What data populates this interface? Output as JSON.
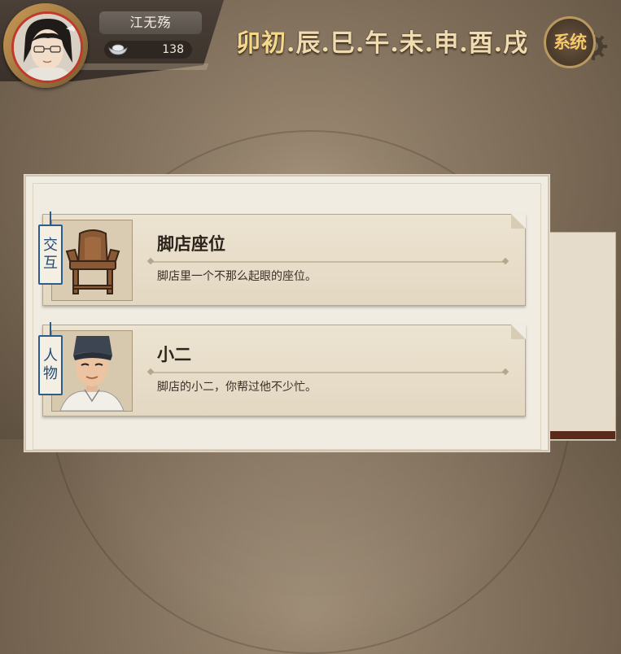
{
  "player": {
    "name": "江无殇",
    "silver": "138",
    "avatar": "scholar-portrait"
  },
  "timebar": {
    "current": "卯初",
    "rest": ".辰.巳.午.未.申.酉.戌"
  },
  "system_button": {
    "label": "系统"
  },
  "dialog": {
    "items": [
      {
        "tag": [
          "交",
          "互"
        ],
        "title": "脚店座位",
        "desc": "脚店里一个不那么起眼的座位。",
        "icon": "chair-icon"
      },
      {
        "tag": [
          "人",
          "物"
        ],
        "title": "小二",
        "desc": "脚店的小二，你帮过他不少忙。",
        "icon": "waiter-portrait"
      }
    ]
  },
  "colors": {
    "tag_blue": "#2e5c8a",
    "accent_gold": "#f5c86a",
    "avatar_ring_red": "#c0392b"
  }
}
